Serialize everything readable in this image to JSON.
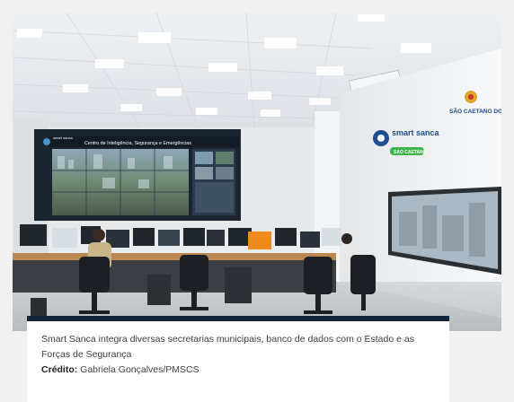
{
  "photo": {
    "video_wall_title": "Centro de Inteligência, Segurança e Emergências",
    "video_wall_logo": "smart sanca",
    "wall_logo_text": "smart sanca",
    "wall_logo_badge": "SAO CAETANO",
    "city_logo_text": "SÃO CAETANO DO SUL"
  },
  "caption": {
    "text": "Smart Sanca integra diversas secretarias municipais, banco de dados com o Estado e as Forças de Segurança",
    "credit_label": "Crédito:",
    "credit_value": "Gabriela Gonçalves/PMSCS"
  },
  "colors": {
    "caption_bar": "#13243b",
    "logo_green": "#3cb44a",
    "logo_blue": "#1d4e8f"
  }
}
